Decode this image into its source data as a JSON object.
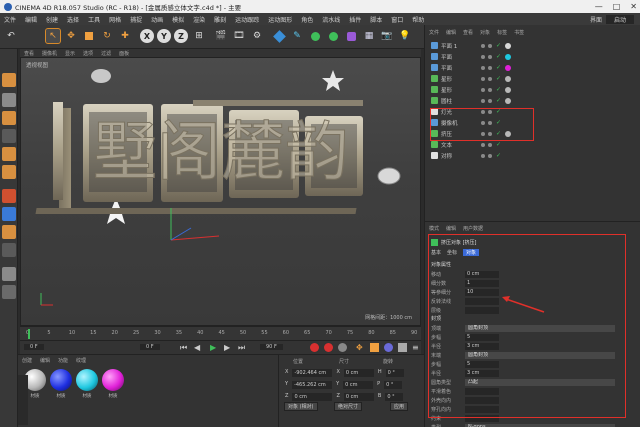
{
  "window": {
    "title": "CINEMA 4D R18.057 Studio (RC - R18) - [金属质感立体文字.c4d *] - 主要",
    "controls": [
      "—",
      "□",
      "✕"
    ]
  },
  "menubar": {
    "items": [
      "文件",
      "编辑",
      "创建",
      "选择",
      "工具",
      "网格",
      "捕捉",
      "动画",
      "模拟",
      "渲染",
      "雕刻",
      "运动跟踪",
      "运动图形",
      "角色",
      "流水线",
      "插件",
      "脚本",
      "窗口",
      "帮助"
    ],
    "layout_label": "界面",
    "layout_value": "启动"
  },
  "toolbar": {
    "axis_labels": [
      "X",
      "Y",
      "Z"
    ]
  },
  "viewport": {
    "menu": [
      "查看",
      "摄像机",
      "显示",
      "选项",
      "过滤",
      "面板"
    ],
    "label": "透视视图",
    "grid": "网格间距：1000 cm",
    "title_text": "墅阁麓韵"
  },
  "timeline": {
    "ticks": [
      "0",
      "5",
      "10",
      "15",
      "20",
      "25",
      "30",
      "35",
      "40",
      "45",
      "50",
      "55",
      "60",
      "65",
      "70",
      "75",
      "80",
      "85",
      "90"
    ],
    "start": "0 F",
    "end": "90 F",
    "current": "0 F"
  },
  "material_manager": {
    "menu": [
      "创建",
      "编辑",
      "功能",
      "纹理"
    ],
    "materials": [
      {
        "label": "材质",
        "color": "#b8b8b8"
      },
      {
        "label": "材质",
        "color": "#1e2fe0"
      },
      {
        "label": "材质",
        "color": "#1ec8e0"
      },
      {
        "label": "材质",
        "color": "#e020d8"
      }
    ]
  },
  "coordinates": {
    "headers": [
      "位置",
      "尺寸",
      "旋转"
    ],
    "rows": [
      [
        "X",
        "-902.464 cm",
        "X",
        "0 cm",
        "H",
        "0 °"
      ],
      [
        "Y",
        "-465.262 cm",
        "Y",
        "0 cm",
        "P",
        "0 °"
      ],
      [
        "Z",
        "0 cm",
        "Z",
        "0 cm",
        "B",
        "0 °"
      ]
    ],
    "mode": "对象 (相对)",
    "size_mode": "绝对尺寸",
    "apply": "应用"
  },
  "object_manager": {
    "menu": [
      "文件",
      "编辑",
      "查看",
      "对象",
      "标签",
      "书签"
    ],
    "objects": [
      {
        "name": "平面 1",
        "icon_color": "#5a9ad8",
        "tag": "#d8d8d8"
      },
      {
        "name": "平面",
        "icon_color": "#5a9ad8",
        "tag": "#1ec8e0"
      },
      {
        "name": "平面",
        "icon_color": "#5a9ad8",
        "tag": "#e020d8"
      },
      {
        "name": "星形",
        "icon_color": "#58b858",
        "tag": "#b8b8b8"
      },
      {
        "name": "星形",
        "icon_color": "#58b858",
        "tag": "#b8b8b8"
      },
      {
        "name": "圆柱",
        "icon_color": "#58b858",
        "tag": "#b8b8b8"
      },
      {
        "name": "灯光",
        "icon_color": "#e0e0e0",
        "tag": ""
      },
      {
        "name": "摄像机",
        "icon_color": "#5a9ad8",
        "tag": ""
      },
      {
        "name": "挤压",
        "icon_color": "#58b858",
        "tag": "#b8b8b8"
      },
      {
        "name": "文本",
        "icon_color": "#58b858",
        "tag": ""
      },
      {
        "name": "对称",
        "icon_color": "#e0e0e0",
        "tag": ""
      }
    ]
  },
  "attribute_manager": {
    "menu": [
      "模式",
      "编辑",
      "用户数据"
    ],
    "object_title": "挤压对象 [挤压]",
    "tabs": [
      "基本",
      "坐标",
      "对象"
    ],
    "section": "对象属性",
    "fields": [
      {
        "label": "移动",
        "value": "0 cm"
      },
      {
        "label": "细分数",
        "value": "1"
      },
      {
        "label": "等参细分",
        "value": "10"
      },
      {
        "label": "反转法线",
        "value": ""
      },
      {
        "label": "层级",
        "value": ""
      }
    ],
    "fillet_section": "封顶",
    "fillet_fields": [
      {
        "label": "顶端",
        "value": "圆角封顶"
      },
      {
        "label": "步幅",
        "value": "5"
      },
      {
        "label": "半径",
        "value": "3 cm"
      },
      {
        "label": "末端",
        "value": "圆角封顶"
      },
      {
        "label": "步幅",
        "value": "5"
      },
      {
        "label": "半径",
        "value": "3 cm"
      },
      {
        "label": "圆角类型",
        "value": "凸起"
      },
      {
        "label": "平滑着色",
        "value": ""
      },
      {
        "label": "外壳向内",
        "value": ""
      },
      {
        "label": "穿孔向内",
        "value": ""
      },
      {
        "label": "约束",
        "value": ""
      },
      {
        "label": "类型",
        "value": "N-gons"
      }
    ]
  },
  "annotations": {
    "box_color": "#e0302a"
  }
}
